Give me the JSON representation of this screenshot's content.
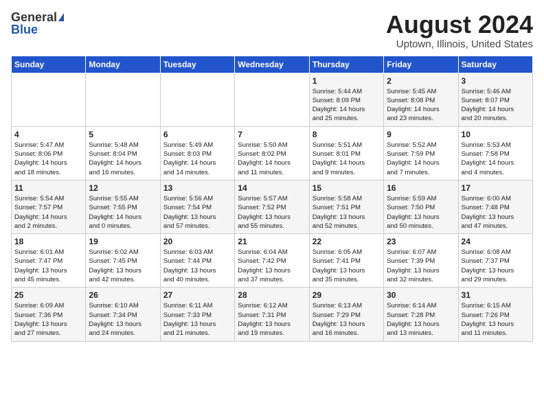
{
  "header": {
    "logo_general": "General",
    "logo_blue": "Blue",
    "month": "August 2024",
    "location": "Uptown, Illinois, United States"
  },
  "days_of_week": [
    "Sunday",
    "Monday",
    "Tuesday",
    "Wednesday",
    "Thursday",
    "Friday",
    "Saturday"
  ],
  "weeks": [
    [
      {
        "day": "",
        "content": ""
      },
      {
        "day": "",
        "content": ""
      },
      {
        "day": "",
        "content": ""
      },
      {
        "day": "",
        "content": ""
      },
      {
        "day": "1",
        "content": "Sunrise: 5:44 AM\nSunset: 8:09 PM\nDaylight: 14 hours\nand 25 minutes."
      },
      {
        "day": "2",
        "content": "Sunrise: 5:45 AM\nSunset: 8:08 PM\nDaylight: 14 hours\nand 23 minutes."
      },
      {
        "day": "3",
        "content": "Sunrise: 5:46 AM\nSunset: 8:07 PM\nDaylight: 14 hours\nand 20 minutes."
      }
    ],
    [
      {
        "day": "4",
        "content": "Sunrise: 5:47 AM\nSunset: 8:06 PM\nDaylight: 14 hours\nand 18 minutes."
      },
      {
        "day": "5",
        "content": "Sunrise: 5:48 AM\nSunset: 8:04 PM\nDaylight: 14 hours\nand 16 minutes."
      },
      {
        "day": "6",
        "content": "Sunrise: 5:49 AM\nSunset: 8:03 PM\nDaylight: 14 hours\nand 14 minutes."
      },
      {
        "day": "7",
        "content": "Sunrise: 5:50 AM\nSunset: 8:02 PM\nDaylight: 14 hours\nand 11 minutes."
      },
      {
        "day": "8",
        "content": "Sunrise: 5:51 AM\nSunset: 8:01 PM\nDaylight: 14 hours\nand 9 minutes."
      },
      {
        "day": "9",
        "content": "Sunrise: 5:52 AM\nSunset: 7:59 PM\nDaylight: 14 hours\nand 7 minutes."
      },
      {
        "day": "10",
        "content": "Sunrise: 5:53 AM\nSunset: 7:58 PM\nDaylight: 14 hours\nand 4 minutes."
      }
    ],
    [
      {
        "day": "11",
        "content": "Sunrise: 5:54 AM\nSunset: 7:57 PM\nDaylight: 14 hours\nand 2 minutes."
      },
      {
        "day": "12",
        "content": "Sunrise: 5:55 AM\nSunset: 7:55 PM\nDaylight: 14 hours\nand 0 minutes."
      },
      {
        "day": "13",
        "content": "Sunrise: 5:56 AM\nSunset: 7:54 PM\nDaylight: 13 hours\nand 57 minutes."
      },
      {
        "day": "14",
        "content": "Sunrise: 5:57 AM\nSunset: 7:52 PM\nDaylight: 13 hours\nand 55 minutes."
      },
      {
        "day": "15",
        "content": "Sunrise: 5:58 AM\nSunset: 7:51 PM\nDaylight: 13 hours\nand 52 minutes."
      },
      {
        "day": "16",
        "content": "Sunrise: 5:59 AM\nSunset: 7:50 PM\nDaylight: 13 hours\nand 50 minutes."
      },
      {
        "day": "17",
        "content": "Sunrise: 6:00 AM\nSunset: 7:48 PM\nDaylight: 13 hours\nand 47 minutes."
      }
    ],
    [
      {
        "day": "18",
        "content": "Sunrise: 6:01 AM\nSunset: 7:47 PM\nDaylight: 13 hours\nand 45 minutes."
      },
      {
        "day": "19",
        "content": "Sunrise: 6:02 AM\nSunset: 7:45 PM\nDaylight: 13 hours\nand 42 minutes."
      },
      {
        "day": "20",
        "content": "Sunrise: 6:03 AM\nSunset: 7:44 PM\nDaylight: 13 hours\nand 40 minutes."
      },
      {
        "day": "21",
        "content": "Sunrise: 6:04 AM\nSunset: 7:42 PM\nDaylight: 13 hours\nand 37 minutes."
      },
      {
        "day": "22",
        "content": "Sunrise: 6:05 AM\nSunset: 7:41 PM\nDaylight: 13 hours\nand 35 minutes."
      },
      {
        "day": "23",
        "content": "Sunrise: 6:07 AM\nSunset: 7:39 PM\nDaylight: 13 hours\nand 32 minutes."
      },
      {
        "day": "24",
        "content": "Sunrise: 6:08 AM\nSunset: 7:37 PM\nDaylight: 13 hours\nand 29 minutes."
      }
    ],
    [
      {
        "day": "25",
        "content": "Sunrise: 6:09 AM\nSunset: 7:36 PM\nDaylight: 13 hours\nand 27 minutes."
      },
      {
        "day": "26",
        "content": "Sunrise: 6:10 AM\nSunset: 7:34 PM\nDaylight: 13 hours\nand 24 minutes."
      },
      {
        "day": "27",
        "content": "Sunrise: 6:11 AM\nSunset: 7:33 PM\nDaylight: 13 hours\nand 21 minutes."
      },
      {
        "day": "28",
        "content": "Sunrise: 6:12 AM\nSunset: 7:31 PM\nDaylight: 13 hours\nand 19 minutes."
      },
      {
        "day": "29",
        "content": "Sunrise: 6:13 AM\nSunset: 7:29 PM\nDaylight: 13 hours\nand 16 minutes."
      },
      {
        "day": "30",
        "content": "Sunrise: 6:14 AM\nSunset: 7:28 PM\nDaylight: 13 hours\nand 13 minutes."
      },
      {
        "day": "31",
        "content": "Sunrise: 6:15 AM\nSunset: 7:26 PM\nDaylight: 13 hours\nand 11 minutes."
      }
    ]
  ]
}
